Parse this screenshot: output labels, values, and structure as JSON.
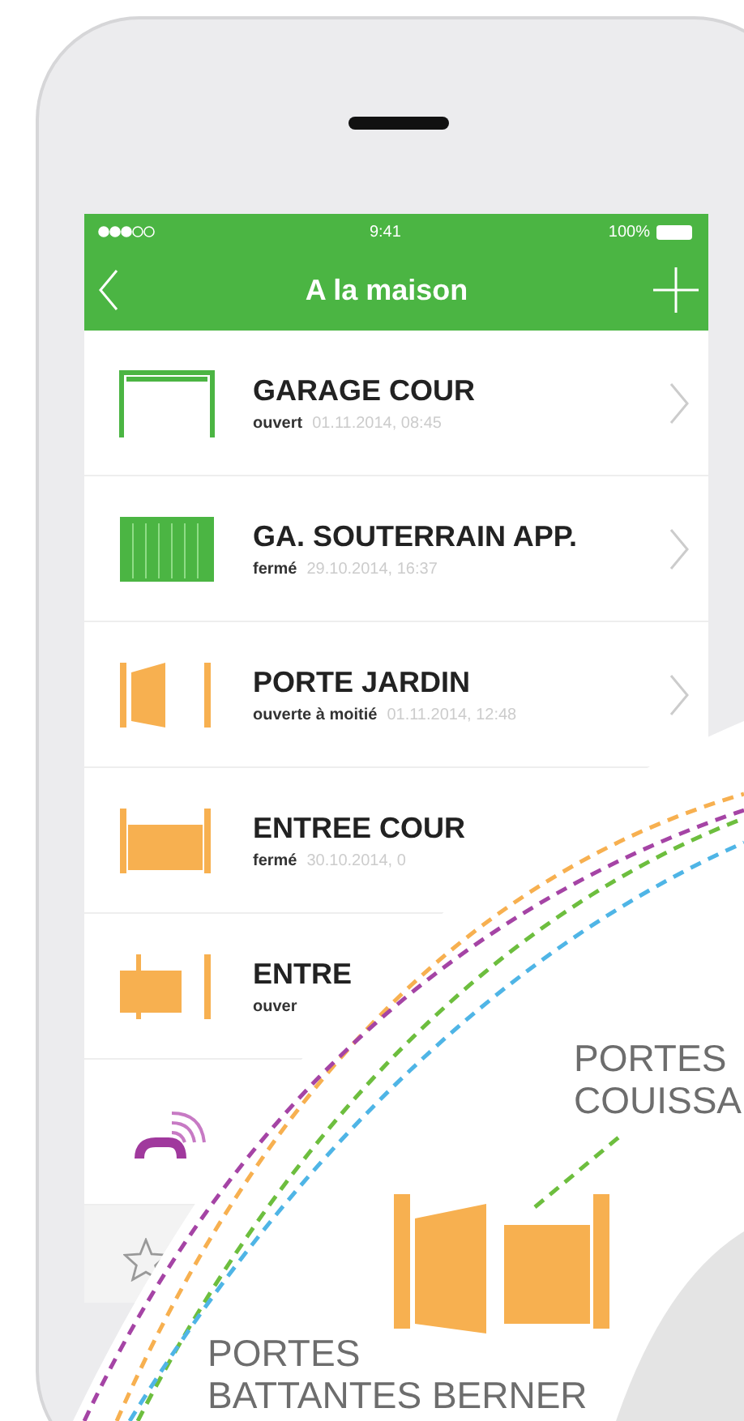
{
  "status_bar": {
    "time": "9:41",
    "battery": "100%"
  },
  "nav_bar": {
    "title": "A la maison"
  },
  "devices": [
    {
      "kind": "garage-open",
      "name": "GARAGE COUR",
      "state": "ouvert",
      "date": "01.11.2014, 08:45",
      "chevron": true
    },
    {
      "kind": "garage-closed",
      "name": "GA. SOUTERRAIN APP.",
      "state": "fermé",
      "date": "29.10.2014, 16:37",
      "chevron": true
    },
    {
      "kind": "gate-half",
      "name": "PORTE JARDIN",
      "state": "ouverte à moitié",
      "date": "01.11.2014, 12:48",
      "chevron": true
    },
    {
      "kind": "gate-closed",
      "name": "ENTREE COUR",
      "state": "fermé",
      "date": "30.10.2014, 0"
    },
    {
      "kind": "gate-partial",
      "name": "ENTRE",
      "state": "ouver"
    },
    {
      "kind": "remote"
    }
  ],
  "overlay_labels": [
    {
      "lines": [
        "PORTES",
        "COUISSA"
      ]
    },
    {
      "lines": [
        "PORTES",
        "BATTANTES BERNER"
      ]
    }
  ]
}
